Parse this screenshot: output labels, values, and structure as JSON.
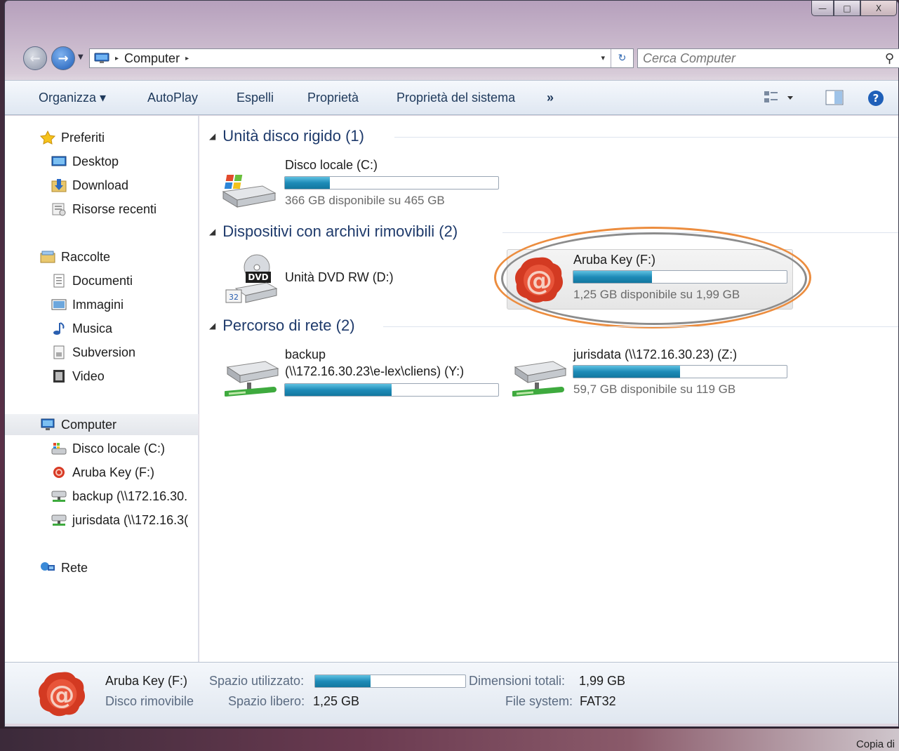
{
  "window": {
    "caption": {
      "minimize": "—",
      "maximize": "□",
      "close": "X"
    }
  },
  "address_bar": {
    "breadcrumb": [
      "Computer"
    ],
    "separator": "▸",
    "dropdown": "▾",
    "refresh": "↻"
  },
  "search": {
    "placeholder": "Cerca Computer",
    "icon": "search-icon"
  },
  "toolbar": {
    "organize": "Organizza ▾",
    "autoplay": "AutoPlay",
    "eject": "Espelli",
    "properties": "Proprietà",
    "system_properties": "Proprietà del sistema",
    "more": "»"
  },
  "navigation": {
    "favorites": {
      "label": "Preferiti",
      "items": [
        {
          "label": "Desktop",
          "icon": "desktop-icon"
        },
        {
          "label": "Download",
          "icon": "download-folder-icon"
        },
        {
          "label": "Risorse recenti",
          "icon": "recent-places-icon"
        }
      ]
    },
    "libraries": {
      "label": "Raccolte",
      "items": [
        {
          "label": "Documenti",
          "icon": "documents-icon"
        },
        {
          "label": "Immagini",
          "icon": "pictures-icon"
        },
        {
          "label": "Musica",
          "icon": "music-icon"
        },
        {
          "label": "Subversion",
          "icon": "subversion-icon"
        },
        {
          "label": "Video",
          "icon": "video-icon"
        }
      ]
    },
    "computer": {
      "label": "Computer",
      "items": [
        {
          "label": "Disco locale (C:)",
          "icon": "hard-drive-icon"
        },
        {
          "label": "Aruba Key (F:)",
          "icon": "aruba-key-icon"
        },
        {
          "label": "backup (\\\\172.16.30.",
          "icon": "network-drive-icon"
        },
        {
          "label": "jurisdata (\\\\172.16.3(",
          "icon": "network-drive-icon"
        }
      ]
    },
    "network": {
      "label": "Rete",
      "icon": "network-icon"
    }
  },
  "groups": {
    "hard_disks": {
      "title": "Unità disco rigido (1)",
      "drives": [
        {
          "name": "Disco locale (C:)",
          "free_text": "366 GB disponibile su 465 GB",
          "used_fraction": 0.21
        }
      ]
    },
    "removable": {
      "title": "Dispositivi con archivi rimovibili (2)",
      "drives": [
        {
          "name": "Unità DVD RW (D:)",
          "icon_label": "DVD"
        },
        {
          "name": "Aruba Key (F:)",
          "free_text": "1,25 GB disponibile su 1,99 GB",
          "used_fraction": 0.37
        }
      ]
    },
    "network": {
      "title": "Percorso di rete (2)",
      "drives": [
        {
          "name": "backup",
          "name_line2": "(\\\\172.16.30.23\\e-lex\\cliens) (Y:)",
          "used_fraction": 0.5
        },
        {
          "name": "jurisdata (\\\\172.16.30.23) (Z:)",
          "free_text": "59,7 GB disponibile su 119 GB",
          "used_fraction": 0.5
        }
      ]
    }
  },
  "details": {
    "name": "Aruba Key (F:)",
    "type": "Disco rimovibile",
    "used_label": "Spazio utilizzato:",
    "used_fraction": 0.37,
    "free_label": "Spazio libero:",
    "free_value": "1,25 GB",
    "total_label": "Dimensioni totali:",
    "total_value": "1,99 GB",
    "fs_label": "File system:",
    "fs_value": "FAT32"
  },
  "desktop": {
    "corner_text": "Copia di"
  },
  "colors": {
    "highlight_orange": "#ec8d3f",
    "progress_blue": "#1e8bb8",
    "group_title": "#1e3a6b"
  }
}
